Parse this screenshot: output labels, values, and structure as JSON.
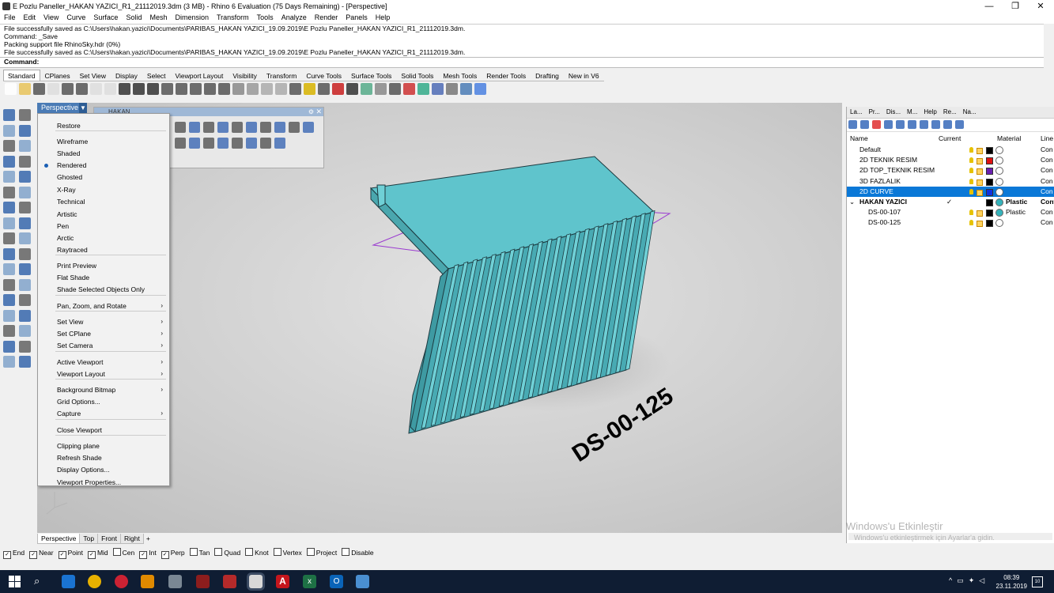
{
  "window": {
    "title": "E Pozlu Paneller_HAKAN YAZICI_R1_21112019.3dm (3 MB) - Rhino 6 Evaluation (75 Days Remaining) - [Perspective]"
  },
  "menu": [
    "File",
    "Edit",
    "View",
    "Curve",
    "Surface",
    "Solid",
    "Mesh",
    "Dimension",
    "Transform",
    "Tools",
    "Analyze",
    "Render",
    "Panels",
    "Help"
  ],
  "command_history": [
    "File successfully saved as C:\\Users\\hakan.yazici\\Documents\\PARIBAS_HAKAN YAZICI_19.09.2019\\E Pozlu Paneller_HAKAN YAZICI_R1_21112019.3dm.",
    "Command: _Save",
    "Packing support file RhinoSky.hdr (0%)",
    "File successfully saved as C:\\Users\\hakan.yazici\\Documents\\PARIBAS_HAKAN YAZICI_19.09.2019\\E Pozlu Paneller_HAKAN YAZICI_R1_21112019.3dm."
  ],
  "command_prompt": "Command:",
  "toolbar_tabs": [
    "Standard",
    "CPlanes",
    "Set View",
    "Display",
    "Select",
    "Viewport Layout",
    "Visibility",
    "Transform",
    "Curve Tools",
    "Surface Tools",
    "Solid Tools",
    "Mesh Tools",
    "Render Tools",
    "Drafting",
    "New in V6"
  ],
  "viewport": {
    "label": "Perspective",
    "floating_toolbar_title": "HAKAN",
    "object_label": "DS-00-125"
  },
  "context_menu": {
    "items": [
      {
        "label": "Restore",
        "arrow": ""
      },
      {
        "label": "Wireframe",
        "arrow": ""
      },
      {
        "label": "Shaded",
        "arrow": ""
      },
      {
        "label": "Rendered",
        "arrow": "",
        "checked": true
      },
      {
        "label": "Ghosted",
        "arrow": ""
      },
      {
        "label": "X-Ray",
        "arrow": ""
      },
      {
        "label": "Technical",
        "arrow": ""
      },
      {
        "label": "Artistic",
        "arrow": ""
      },
      {
        "label": "Pen",
        "arrow": ""
      },
      {
        "label": "Arctic",
        "arrow": ""
      },
      {
        "label": "Raytraced",
        "arrow": ""
      },
      {
        "label": "Print Preview",
        "arrow": ""
      },
      {
        "label": "Flat Shade",
        "arrow": ""
      },
      {
        "label": "Shade Selected Objects Only",
        "arrow": ""
      },
      {
        "label": "Pan, Zoom, and Rotate",
        "arrow": "›"
      },
      {
        "label": "Set View",
        "arrow": "›"
      },
      {
        "label": "Set CPlane",
        "arrow": "›"
      },
      {
        "label": "Set Camera",
        "arrow": "›"
      },
      {
        "label": "Active Viewport",
        "arrow": "›"
      },
      {
        "label": "Viewport Layout",
        "arrow": "›"
      },
      {
        "label": "Background Bitmap",
        "arrow": "›"
      },
      {
        "label": "Grid Options...",
        "arrow": ""
      },
      {
        "label": "Capture",
        "arrow": "›"
      },
      {
        "label": "Close Viewport",
        "arrow": ""
      },
      {
        "label": "Clipping plane",
        "arrow": ""
      },
      {
        "label": "Refresh Shade",
        "arrow": ""
      },
      {
        "label": "Display Options...",
        "arrow": ""
      },
      {
        "label": "Viewport Properties...",
        "arrow": ""
      }
    ]
  },
  "viewport_tabs": [
    "Perspective",
    "Top",
    "Front",
    "Right"
  ],
  "viewport_tabs_add": "+",
  "osnap": [
    {
      "label": "End",
      "checked": true
    },
    {
      "label": "Near",
      "checked": true
    },
    {
      "label": "Point",
      "checked": true
    },
    {
      "label": "Mid",
      "checked": true
    },
    {
      "label": "Cen",
      "checked": false
    },
    {
      "label": "Int",
      "checked": true
    },
    {
      "label": "Perp",
      "checked": true
    },
    {
      "label": "Tan",
      "checked": false
    },
    {
      "label": "Quad",
      "checked": false
    },
    {
      "label": "Knot",
      "checked": false
    },
    {
      "label": "Vertex",
      "checked": false
    },
    {
      "label": "Project",
      "checked": false
    },
    {
      "label": "Disable",
      "checked": false
    }
  ],
  "right_panel": {
    "tabs": [
      "La...",
      "Pr...",
      "Dis...",
      "M...",
      "Help",
      "Re...",
      "Na..."
    ],
    "headers": {
      "name": "Name",
      "current": "Current",
      "material": "Material",
      "linetype": "Line"
    },
    "layers": [
      {
        "name": "Default",
        "indent": 1,
        "current": "",
        "color": "#000000",
        "material": "",
        "linetype": "Con",
        "bold": false,
        "selected": false
      },
      {
        "name": "2D TEKNIK RESIM",
        "indent": 1,
        "current": "",
        "color": "#e01010",
        "material": "",
        "linetype": "Con",
        "bold": false,
        "selected": false
      },
      {
        "name": "2D TOP_TEKNIK RESIM",
        "indent": 1,
        "current": "",
        "color": "#6a1fb0",
        "material": "",
        "linetype": "Con",
        "bold": false,
        "selected": false
      },
      {
        "name": "3D FAZLALIK",
        "indent": 1,
        "current": "",
        "color": "#000000",
        "material": "",
        "linetype": "Con",
        "bold": false,
        "selected": false
      },
      {
        "name": "2D CURVE",
        "indent": 1,
        "current": "",
        "color": "#1030e0",
        "material": "",
        "linetype": "Con",
        "bold": false,
        "selected": true
      },
      {
        "name": "HAKAN YAZICI",
        "indent": 0,
        "current": "✓",
        "color": "#000000",
        "material": "Plastic",
        "linetype": "Cont",
        "bold": true,
        "selected": false
      },
      {
        "name": "DS-00-107",
        "indent": 2,
        "current": "",
        "color": "#000000",
        "material": "Plastic",
        "linetype": "Con",
        "bold": false,
        "selected": false
      },
      {
        "name": "DS-00-125",
        "indent": 2,
        "current": "",
        "color": "#000000",
        "material": "",
        "linetype": "Con",
        "bold": false,
        "selected": false
      }
    ],
    "expander": "⌄"
  },
  "watermark": {
    "line1": "Windows'u Etkinleştir",
    "line2": "Windows'u etkinleştirmek için Ayarlar'a gidin."
  },
  "taskbar": {
    "time": "08:39",
    "date": "23.11.2019",
    "notif_count": "10"
  },
  "colors": {
    "accent": "#0a78d7",
    "model": "#5fc4cc",
    "viewport_label": "#4a7bb5"
  }
}
